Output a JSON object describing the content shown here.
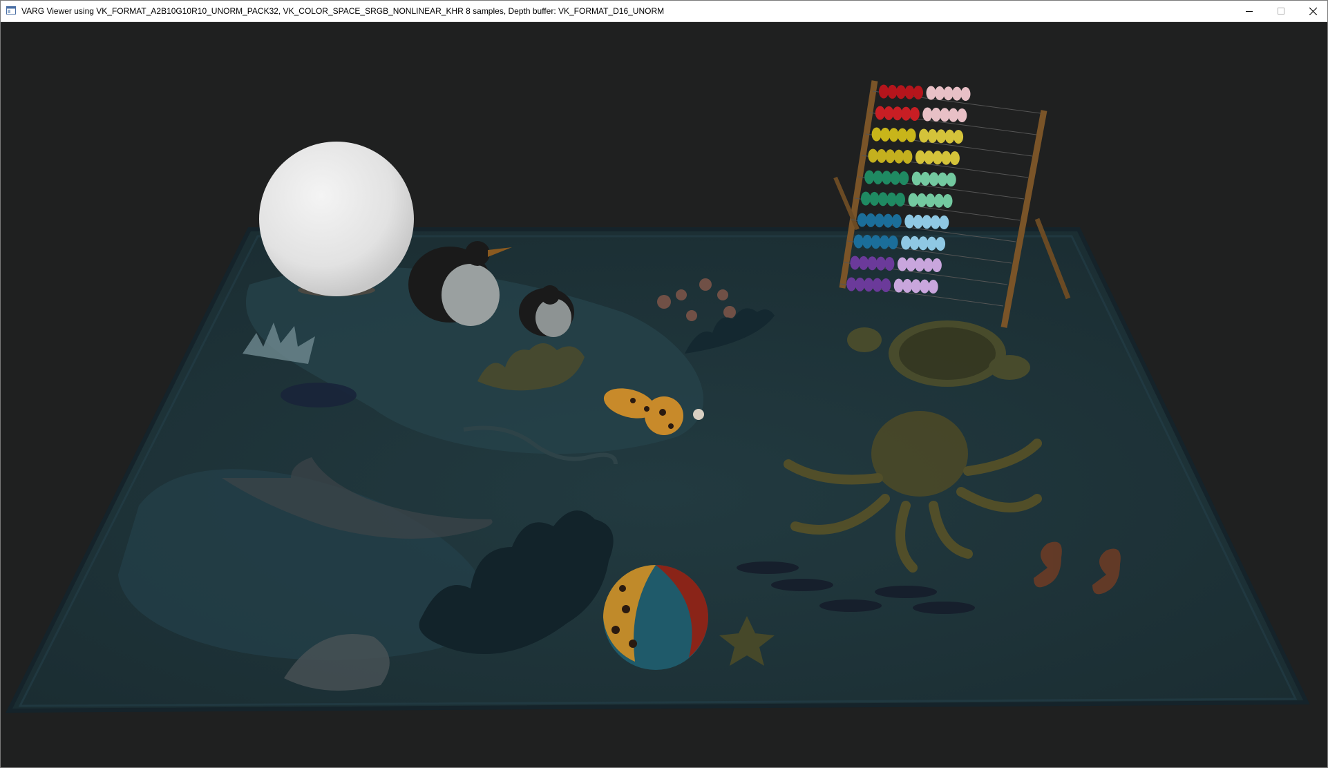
{
  "window": {
    "title": "VARG Viewer using VK_FORMAT_A2B10G10R10_UNORM_PACK32, VK_COLOR_SPACE_SRGB_NONLINEAR_KHR 8 samples, Depth buffer: VK_FORMAT_D16_UNORM",
    "icon": "app-window-icon",
    "controls": {
      "minimize": "minimize-icon",
      "maximize": "maximize-icon",
      "close": "close-icon"
    }
  },
  "scene": {
    "background_color": "#1f2020",
    "rug_color": "#1d3238",
    "abacus_bead_colors": [
      "#b5151c",
      "#c81e24",
      "#c8b51a",
      "#c4b01e",
      "#1f8a62",
      "#1f8a62",
      "#1b6e9a",
      "#1b6e9a",
      "#6b3a9a",
      "#6b3a9a"
    ],
    "abacus_light_bead_colors": [
      "#e8c0c6",
      "#e8c0c6",
      "#d4c33a",
      "#d4c33a",
      "#73c9a0",
      "#73c9a0",
      "#8fc8e3",
      "#8fc8e3",
      "#c9a6dd",
      "#c9a6dd"
    ]
  }
}
